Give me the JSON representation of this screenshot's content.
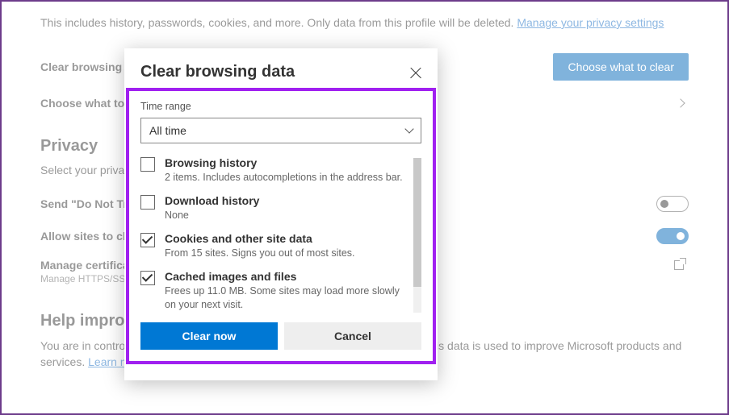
{
  "intro": {
    "text": "This includes history, passwords, cookies, and more. Only data from this profile will be deleted. ",
    "link": "Manage your privacy settings"
  },
  "rows": {
    "clear_browsing": "Clear browsing data",
    "choose_button": "Choose what to clear",
    "choose_close": "Choose what to clear every time you close the browser"
  },
  "privacy": {
    "title": "Privacy",
    "subtitle": "Select your privacy settings for Microsoft Edge.",
    "dnt_label": "Send \"Do Not Track\" requests",
    "allow_sites": "Allow sites to check if you have payment methods saved",
    "manage_certs": "Manage certificates",
    "manage_certs_desc": "Manage HTTPS/SSL certificates and settings"
  },
  "help": {
    "title": "Help improve Microsoft Edge",
    "body_prefix": "You are in control of your data. To set what data you share, select ",
    "body_suffix": ". This data is used to improve Microsoft products and services. ",
    "link": "Learn more about these settings"
  },
  "dialog": {
    "title": "Clear browsing data",
    "time_range_label": "Time range",
    "time_range_value": "All time",
    "items": [
      {
        "label": "Browsing history",
        "desc": "2 items. Includes autocompletions in the address bar.",
        "checked": false
      },
      {
        "label": "Download history",
        "desc": "None",
        "checked": false
      },
      {
        "label": "Cookies and other site data",
        "desc": "From 15 sites. Signs you out of most sites.",
        "checked": true
      },
      {
        "label": "Cached images and files",
        "desc": "Frees up 11.0 MB. Some sites may load more slowly on your next visit.",
        "checked": true
      }
    ],
    "clear_button": "Clear now",
    "cancel_button": "Cancel"
  }
}
